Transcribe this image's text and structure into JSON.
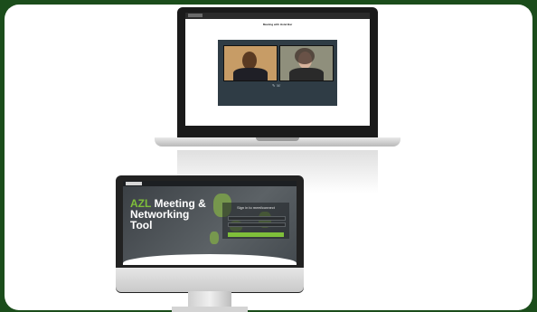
{
  "laptop": {
    "title": "Meeting with Hotel Bar",
    "subtitle": "",
    "warning": "",
    "sidebar_items": [
      "",
      "",
      "",
      ""
    ],
    "right_items": [
      "",
      "",
      ""
    ],
    "controls": "✎ ☏",
    "caption": ""
  },
  "desktop": {
    "headline_accent": "AZL",
    "headline_rest": " Meeting & Networking Tool",
    "description": "",
    "login_title": "Sign in to meet/connect"
  },
  "colors": {
    "page_bg": "#1b4d1b",
    "accent_green": "#7fbf3a",
    "video_bg": "#2f3c45"
  }
}
